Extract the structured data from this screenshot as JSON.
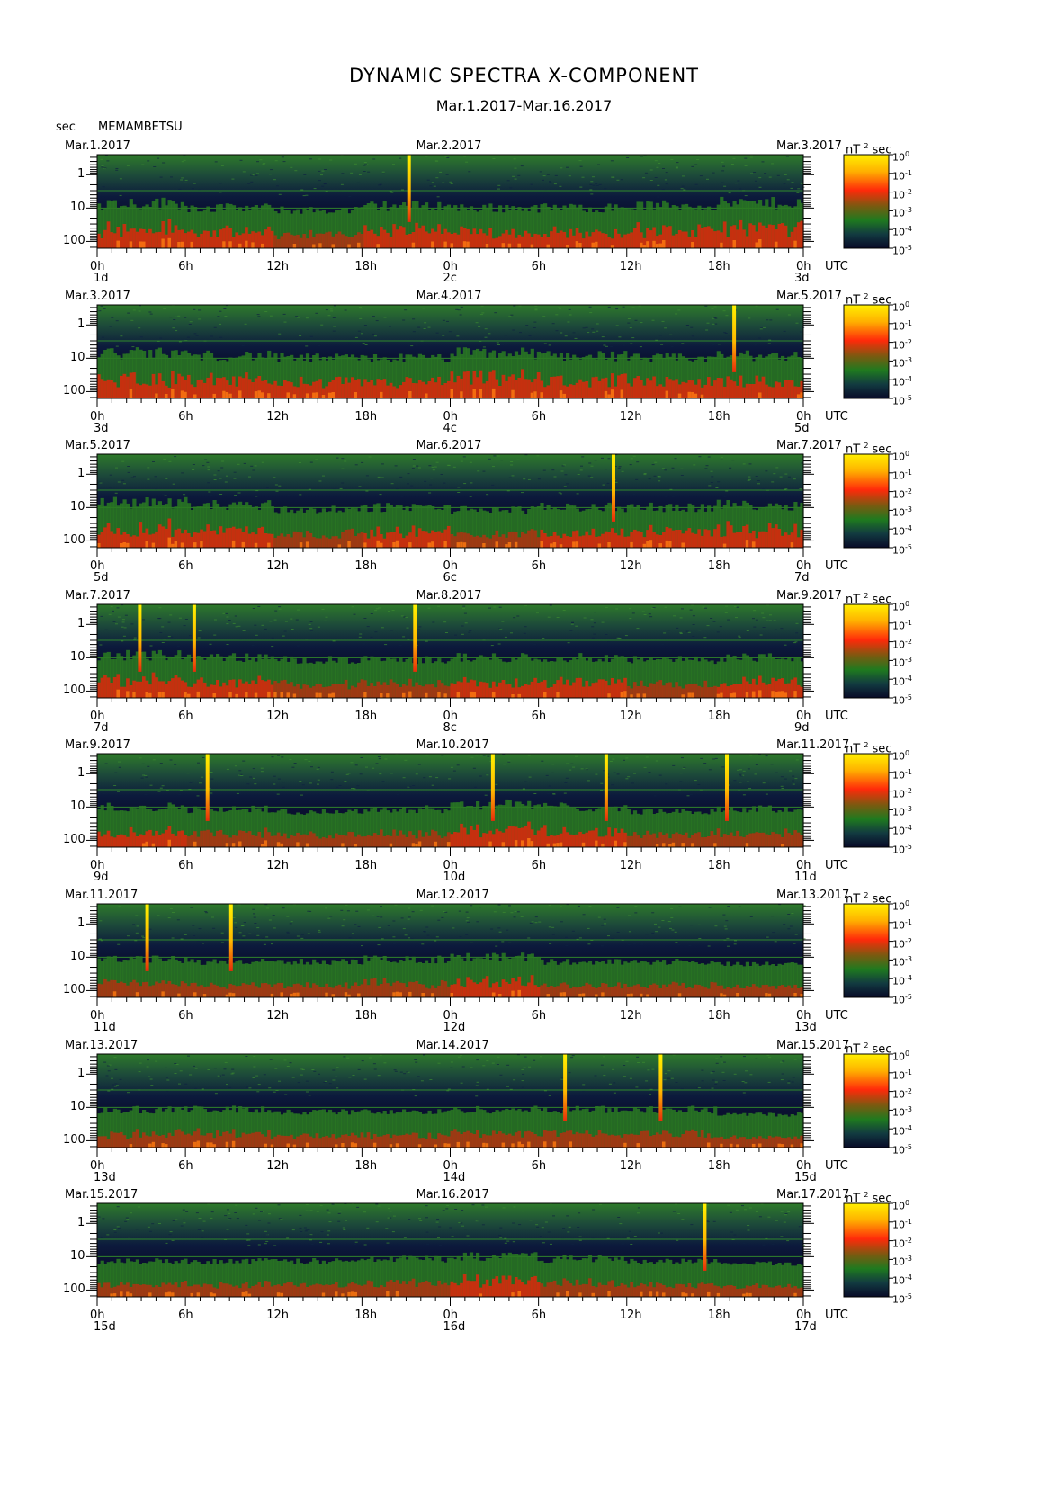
{
  "header": {
    "title": "DYNAMIC SPECTRA X-COMPONENT",
    "subtitle": "Mar.1.2017-Mar.16.2017",
    "y_unit": "sec",
    "station": "MEMAMBETSU"
  },
  "colors": {
    "background": "#ffffff",
    "low": "#0a0e2a",
    "mid": "#1f6a1f",
    "high": "#e81a0a",
    "peak": "#ffee00"
  },
  "chart_data": {
    "type": "heatmap",
    "title": "DYNAMIC SPECTRA X-COMPONENT",
    "subtitle": "Mar.1.2017-Mar.16.2017",
    "station": "MEMAMBETSU",
    "ylabel": "sec",
    "y_scale": "log",
    "y_ticks": [
      "1",
      "10",
      "100"
    ],
    "x_ticks": [
      "0h",
      "6h",
      "12h",
      "18h",
      "0h",
      "6h",
      "12h",
      "18h",
      "0h"
    ],
    "x_unit": "UTC",
    "colorbar": {
      "unit": "nT",
      "unit_sup": "2",
      "unit_after": "sec",
      "labels": [
        {
          "base": "10",
          "exp": "0"
        },
        {
          "base": "10",
          "exp": "-1"
        },
        {
          "base": "10",
          "exp": "-2"
        },
        {
          "base": "10",
          "exp": "-3"
        },
        {
          "base": "10",
          "exp": "-4"
        },
        {
          "base": "10",
          "exp": "-5"
        }
      ]
    },
    "panels": [
      {
        "date_left": "Mar.1.2017",
        "date_mid": "Mar.2.2017",
        "date_right": "Mar.3.2017",
        "day_left": "1d",
        "day_mid": "2c",
        "day_right": "3d",
        "spikes_hours": [
          21.2
        ],
        "activity": [
          0.8,
          0.6,
          0.5,
          0.7,
          0.6,
          0.6,
          0.7,
          0.8
        ]
      },
      {
        "date_left": "Mar.3.2017",
        "date_mid": "Mar.4.2017",
        "date_right": "Mar.5.2017",
        "day_left": "3d",
        "day_mid": "4c",
        "day_right": "5d",
        "spikes_hours": [
          43.3
        ],
        "activity": [
          0.8,
          0.7,
          0.6,
          0.6,
          0.8,
          0.7,
          0.6,
          0.7
        ]
      },
      {
        "date_left": "Mar.5.2017",
        "date_mid": "Mar.6.2017",
        "date_right": "Mar.7.2017",
        "day_left": "5d",
        "day_mid": "6c",
        "day_right": "7d",
        "spikes_hours": [
          35.1
        ],
        "activity": [
          0.8,
          0.7,
          0.5,
          0.6,
          0.5,
          0.6,
          0.6,
          0.7
        ]
      },
      {
        "date_left": "Mar.7.2017",
        "date_mid": "Mar.8.2017",
        "date_right": "Mar.9.2017",
        "day_left": "7d",
        "day_mid": "8c",
        "day_right": "9d",
        "spikes_hours": [
          2.9,
          6.6,
          21.6
        ],
        "activity": [
          0.7,
          0.6,
          0.5,
          0.5,
          0.6,
          0.6,
          0.5,
          0.6
        ]
      },
      {
        "date_left": "Mar.9.2017",
        "date_mid": "Mar.10.2017",
        "date_right": "Mar.11.2017",
        "day_left": "9d",
        "day_mid": "10d",
        "day_right": "11d",
        "spikes_hours": [
          7.5,
          26.9,
          34.6,
          42.8
        ],
        "activity": [
          0.6,
          0.5,
          0.4,
          0.5,
          0.7,
          0.6,
          0.4,
          0.5
        ]
      },
      {
        "date_left": "Mar.11.2017",
        "date_mid": "Mar.12.2017",
        "date_right": "Mar.13.2017",
        "day_left": "11d",
        "day_mid": "12d",
        "day_right": "13d",
        "spikes_hours": [
          3.4,
          9.1
        ],
        "activity": [
          0.5,
          0.4,
          0.4,
          0.5,
          0.6,
          0.4,
          0.4,
          0.3
        ]
      },
      {
        "date_left": "Mar.13.2017",
        "date_mid": "Mar.14.2017",
        "date_right": "Mar.15.2017",
        "day_left": "13d",
        "day_mid": "14d",
        "day_right": "15d",
        "spikes_hours": [
          31.8,
          38.3
        ],
        "activity": [
          0.5,
          0.5,
          0.4,
          0.4,
          0.5,
          0.5,
          0.5,
          0.3
        ]
      },
      {
        "date_left": "Mar.15.2017",
        "date_mid": "Mar.16.2017",
        "date_right": "Mar.17.2017",
        "day_left": "15d",
        "day_mid": "16d",
        "day_right": "17d",
        "spikes_hours": [
          41.3
        ],
        "activity": [
          0.4,
          0.4,
          0.4,
          0.5,
          0.6,
          0.5,
          0.4,
          0.3
        ]
      }
    ]
  }
}
